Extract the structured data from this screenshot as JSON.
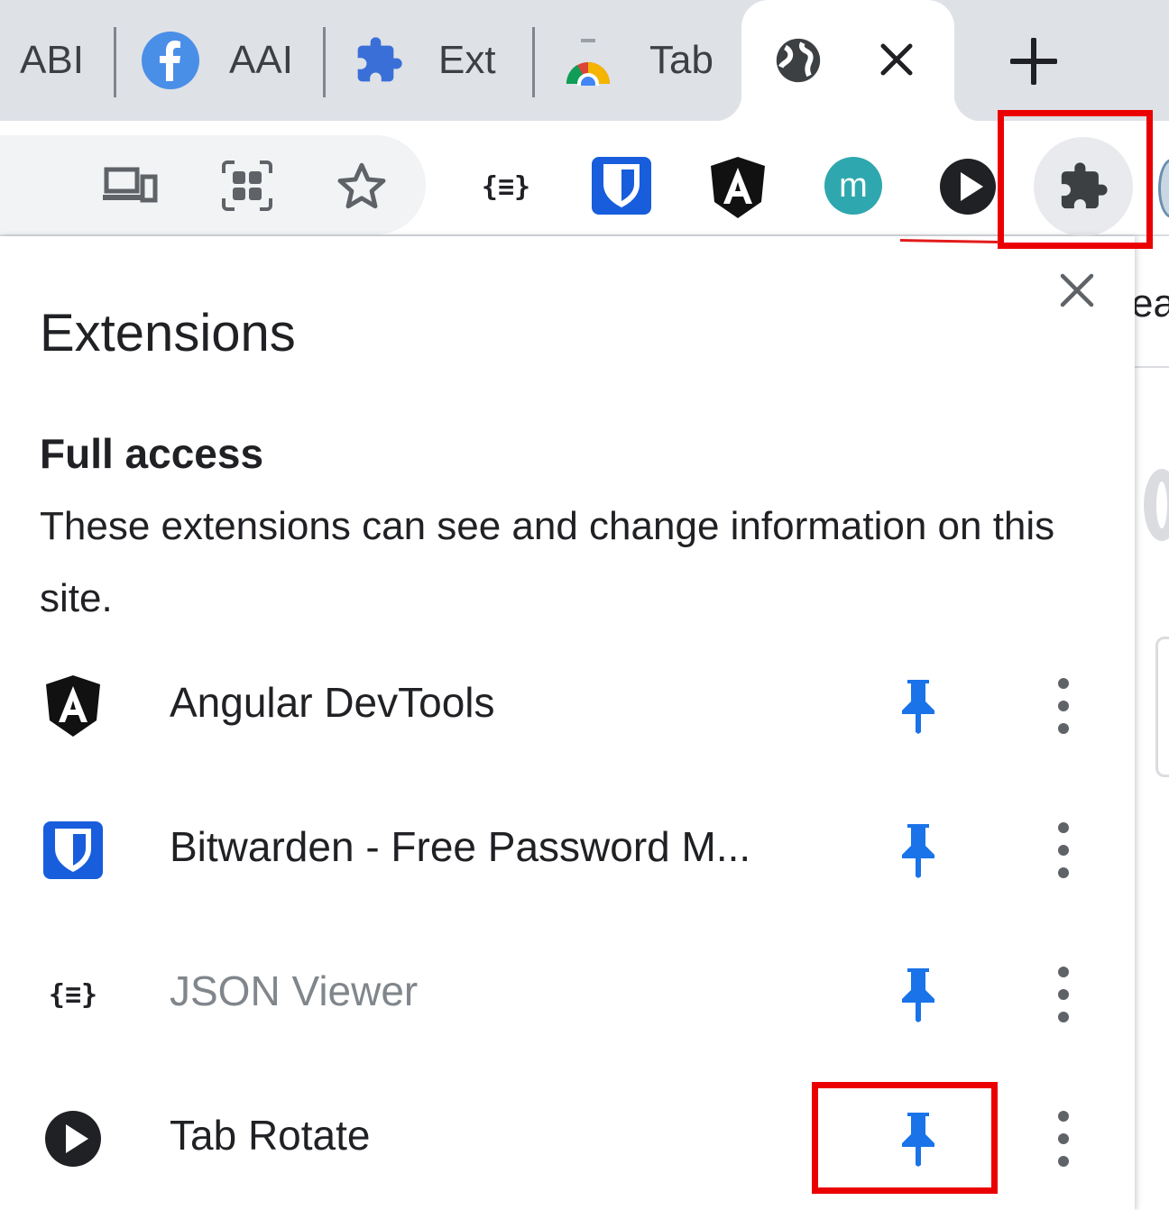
{
  "tabs": [
    {
      "title": "ABI",
      "icon": "none"
    },
    {
      "title": "AAI",
      "icon": "facebook-icon"
    },
    {
      "title": "Ext",
      "icon": "puzzle-icon"
    },
    {
      "title": "Tab",
      "icon": "chrome-icon"
    }
  ],
  "active_tab": {
    "icon": "globe-icon",
    "close_icon": "close-icon"
  },
  "new_tab_icon": "plus-icon",
  "toolbar": {
    "icons": [
      "cast-devices-icon",
      "qr-code-icon",
      "star-icon"
    ],
    "extensions": [
      "json-viewer-icon",
      "bitwarden-icon",
      "angular-icon",
      "m-icon",
      "tab-rotate-icon"
    ],
    "extensions_button_icon": "puzzle-icon",
    "m_letter": "m",
    "json_glyph": "{≡}"
  },
  "side_fragment": "ea",
  "popup": {
    "title": "Extensions",
    "close_icon": "close-icon",
    "section_title": "Full access",
    "section_description": "These extensions can see and change information on this site.",
    "extensions": [
      {
        "name": "Angular DevTools",
        "icon": "angular-icon",
        "pinned": true,
        "disabled": false
      },
      {
        "name": "Bitwarden - Free Password M...",
        "icon": "bitwarden-icon",
        "pinned": true,
        "disabled": false
      },
      {
        "name": "JSON Viewer",
        "icon": "json-viewer-icon",
        "pinned": true,
        "disabled": true
      },
      {
        "name": "Tab Rotate",
        "icon": "tab-rotate-icon",
        "pinned": true,
        "disabled": false
      }
    ]
  },
  "colors": {
    "pin": "#1a73e8",
    "highlight": "#ea0000",
    "tabstrip": "#dee1e6"
  }
}
